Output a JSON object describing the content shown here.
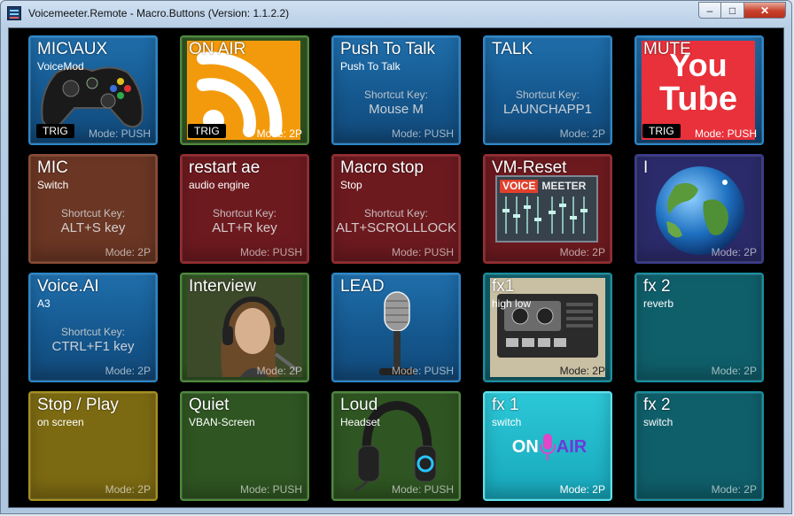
{
  "window": {
    "title": "Voicemeeter.Remote - Macro.Buttons (Version: 1.1.2.2)",
    "controls": {
      "minimize": "–",
      "maximize": "□",
      "close": "✕"
    }
  },
  "buttons": [
    {
      "label": "MIC\\AUX",
      "sub": "VoiceMod",
      "mode": "Mode: PUSH",
      "trig": "TRIG",
      "image": "gamepad-icon"
    },
    {
      "label": "ON AIR",
      "mode": "Mode: 2P",
      "trig": "TRIG",
      "image": "rss-feed-icon",
      "accent": "#f39a0c"
    },
    {
      "label": "Push To Talk",
      "sub": "Push To Talk",
      "shortcut_title": "Shortcut Key:",
      "shortcut": "Mouse M",
      "mode": "Mode: PUSH"
    },
    {
      "label": "TALK",
      "shortcut_title": "Shortcut Key:",
      "shortcut": "LAUNCHAPP1",
      "mode": "Mode: 2P"
    },
    {
      "label": "MUTE",
      "mode": "Mode: PUSH",
      "trig": "TRIG",
      "image": "youtube-logo",
      "logo_top": "You",
      "logo_bottom": "Tube",
      "accent": "#e8313a"
    },
    {
      "label": "MIC",
      "sub": "Switch",
      "shortcut_title": "Shortcut Key:",
      "shortcut": "ALT+S key",
      "mode": "Mode: 2P"
    },
    {
      "label": "restart ae",
      "sub": "audio engine",
      "shortcut_title": "Shortcut Key:",
      "shortcut": "ALT+R key",
      "mode": "Mode: PUSH"
    },
    {
      "label": "Macro stop",
      "sub": "Stop",
      "shortcut_title": "Shortcut Key:",
      "shortcut": "ALT+SCROLLLOCK",
      "mode": "Mode: PUSH"
    },
    {
      "label": "VM-Reset",
      "mode": "Mode: 2P",
      "image": "voicemeeter-logo",
      "logo_left": "VOICE",
      "logo_right": "MEETER"
    },
    {
      "label": "I",
      "mode": "Mode: 2P",
      "image": "globe-icon"
    },
    {
      "label": "Voice.AI",
      "sub": "A3",
      "shortcut_title": "Shortcut Key:",
      "shortcut": "CTRL+F1 key",
      "mode": "Mode: 2P"
    },
    {
      "label": "Interview",
      "mode": "Mode: 2P",
      "image": "headphones-woman-photo"
    },
    {
      "label": "LEAD",
      "mode": "Mode: PUSH",
      "image": "microphone-icon"
    },
    {
      "label": "fx1",
      "sub": "high low",
      "mode": "Mode: 2P",
      "image": "cassette-recorder-photo"
    },
    {
      "label": "fx 2",
      "sub": "reverb",
      "mode": "Mode: 2P"
    },
    {
      "label": "Stop / Play",
      "sub": "on screen",
      "mode": "Mode: 2P"
    },
    {
      "label": "Quiet",
      "sub": "VBAN-Screen",
      "mode": "Mode: PUSH"
    },
    {
      "label": "Loud",
      "sub": "Headset",
      "mode": "Mode: PUSH",
      "image": "headset-icon"
    },
    {
      "label": "fx 1",
      "sub": "switch",
      "mode": "Mode: 2P",
      "image": "on-air-mic-logo",
      "logo_left": "ON",
      "logo_right": "AIR"
    },
    {
      "label": "fx 2",
      "sub": "switch",
      "mode": "Mode: 2P"
    }
  ],
  "colors": {
    "window_bg": "#b9cfe6",
    "panel_bg": "#000000",
    "blue": "#14568c",
    "green": "#2f5522",
    "brown": "#6b3624",
    "red": "#6d1a1f",
    "navy": "#2b2b6b",
    "teal": "#0f5f6b",
    "olive": "#7c6a12",
    "cyan": "#17a7bb"
  }
}
